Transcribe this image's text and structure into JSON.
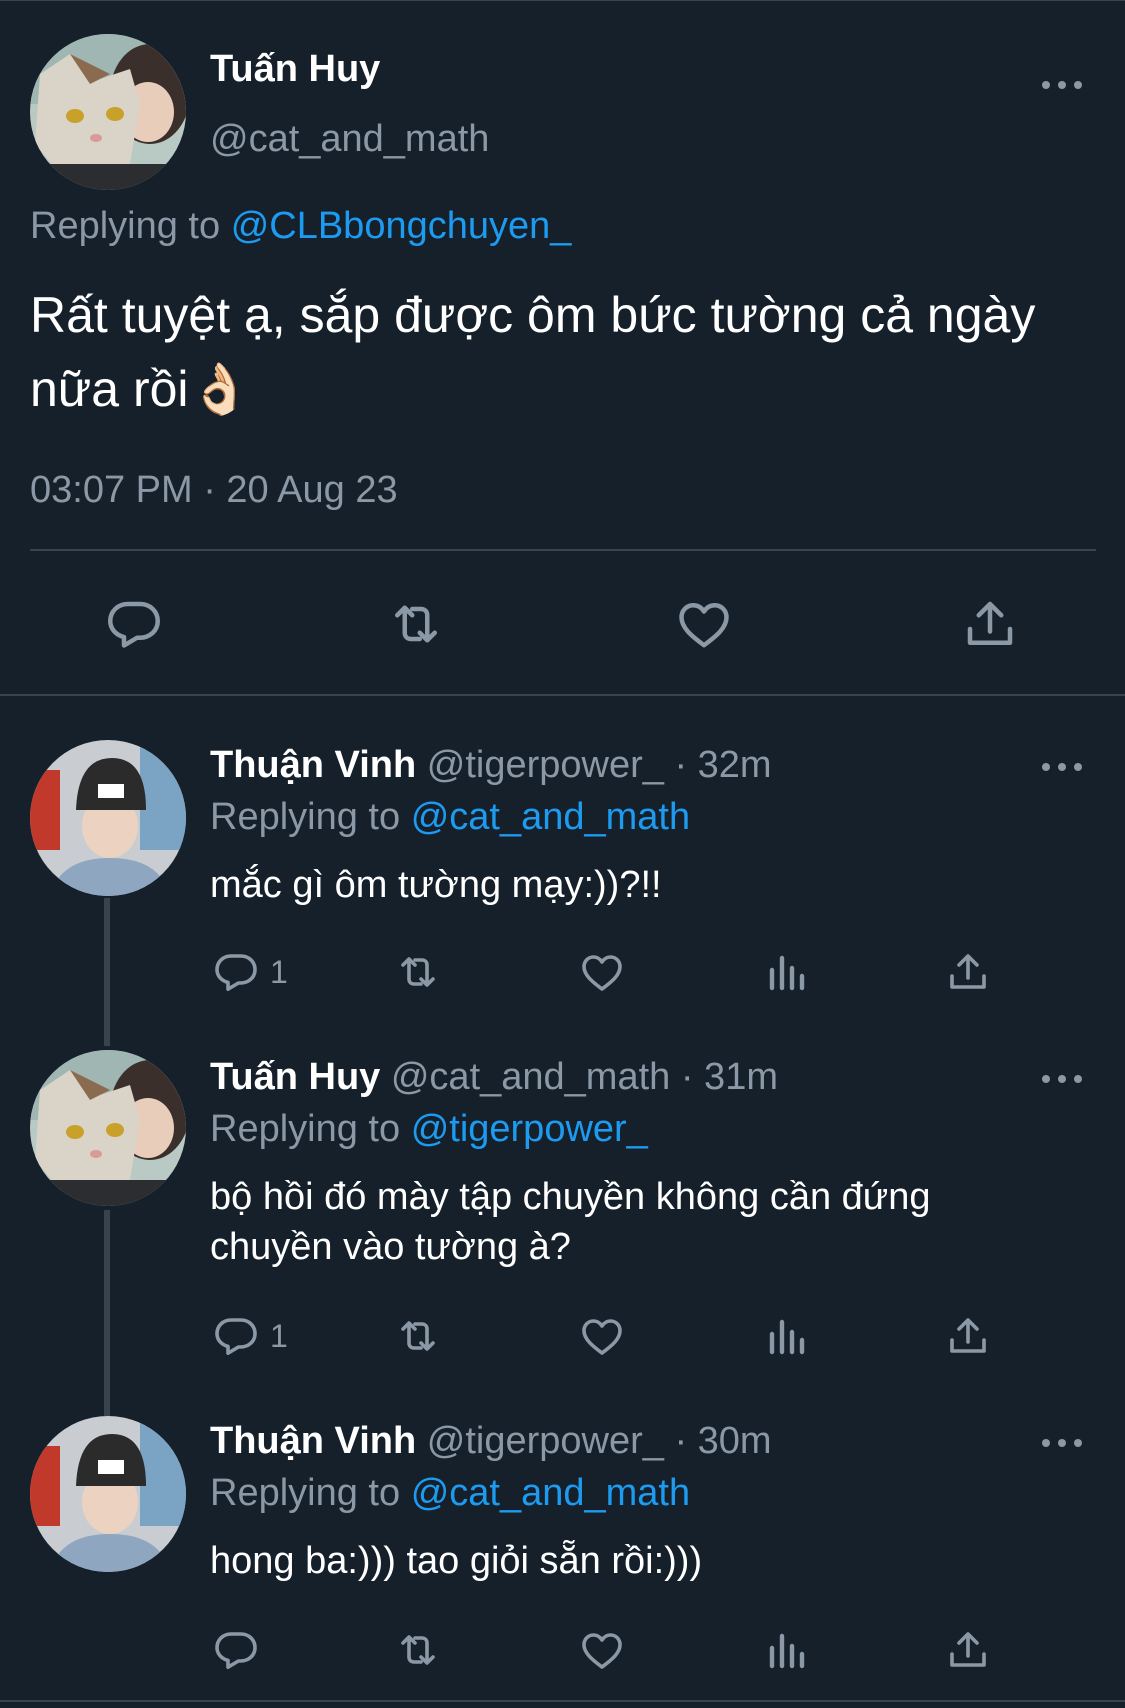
{
  "main_tweet": {
    "name": "Tuấn Huy",
    "handle": "@cat_and_math",
    "replying_prefix": "Replying to",
    "replying_to": "@CLBbongchuyen_",
    "text": "Rất tuyệt ạ, sắp được ôm bức tường cả ngày nữa rồi",
    "emoji": "👌🏻",
    "timestamp": "03:07 PM · 20 Aug 23"
  },
  "replies": [
    {
      "name": "Thuận Vinh",
      "handle": "@tigerpower_",
      "time": "· 32m",
      "replying_prefix": "Replying to",
      "replying_to": "@cat_and_math",
      "text": "mắc gì ôm tường mạy:))?!!",
      "reply_count": "1"
    },
    {
      "name": "Tuấn Huy",
      "handle": "@cat_and_math",
      "time": "· 31m",
      "replying_prefix": "Replying to",
      "replying_to": "@tigerpower_",
      "text_line1": "bộ hồi đó mày tập chuyền không cần đứng",
      "text_line2": "chuyền vào tường à?",
      "reply_count": "1"
    },
    {
      "name": "Thuận Vinh",
      "handle": "@tigerpower_",
      "time": "· 30m",
      "replying_prefix": "Replying to",
      "replying_to": "@cat_and_math",
      "text": "hong ba:))) tao giỏi sẵn rồi:)))",
      "reply_count": ""
    }
  ],
  "colors": {
    "background": "#15202b",
    "text": "#ffffff",
    "muted": "#8b98a5",
    "link": "#1d9bf0",
    "divider": "#38444d"
  },
  "icons": [
    "reply-icon",
    "retweet-icon",
    "like-icon",
    "share-icon",
    "analytics-icon",
    "more-icon"
  ]
}
